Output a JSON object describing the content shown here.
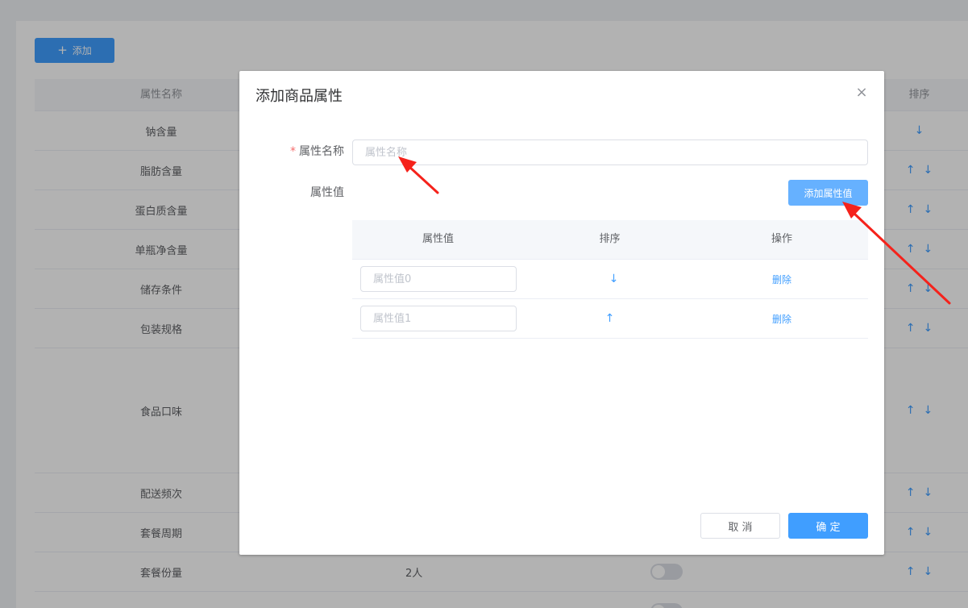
{
  "background": {
    "add_button": {
      "icon": "+",
      "label": "添加"
    },
    "table": {
      "headers": {
        "name": "属性名称",
        "sort": "排序"
      },
      "rows": [
        {
          "name": "钠含量",
          "value": "",
          "sort": [
            "↓"
          ]
        },
        {
          "name": "脂肪含量",
          "value": "",
          "sort": [
            "↑",
            "↓"
          ]
        },
        {
          "name": "蛋白质含量",
          "value": "",
          "sort": [
            "↑",
            "↓"
          ]
        },
        {
          "name": "单瓶净含量",
          "value": "",
          "sort": [
            "↑",
            "↓"
          ]
        },
        {
          "name": "储存条件",
          "value": "",
          "sort": [
            "↑",
            "↓"
          ]
        },
        {
          "name": "包装规格",
          "value": "",
          "sort": [
            "↑",
            "↓"
          ]
        },
        {
          "name": "食品口味",
          "value": "",
          "sort": [
            "↑",
            "↓"
          ]
        },
        {
          "name": "配送频次",
          "value": "",
          "sort": [
            "↑",
            "↓"
          ]
        },
        {
          "name": "套餐周期",
          "value": "",
          "sort": [
            "↑",
            "↓"
          ]
        },
        {
          "name": "套餐份量",
          "value": "2人",
          "sort": [
            "↑",
            "↓"
          ]
        }
      ]
    }
  },
  "dialog": {
    "title": "添加商品属性",
    "close_icon": "×",
    "name_field": {
      "required_mark": "*",
      "label": "属性名称",
      "placeholder": "属性名称",
      "value": ""
    },
    "values_label": "属性值",
    "add_value_button": "添加属性值",
    "values_table": {
      "headers": [
        "属性值",
        "排序",
        "操作"
      ],
      "rows": [
        {
          "placeholder": "属性值0",
          "sort_icon": "↓",
          "action": "删除"
        },
        {
          "placeholder": "属性值1",
          "sort_icon": "↑",
          "action": "删除"
        }
      ]
    },
    "cancel_button": "取 消",
    "confirm_button": "确 定"
  },
  "colors": {
    "primary": "#409eff",
    "primary_light": "#66b1ff",
    "annotation_arrow": "#f5221b"
  }
}
